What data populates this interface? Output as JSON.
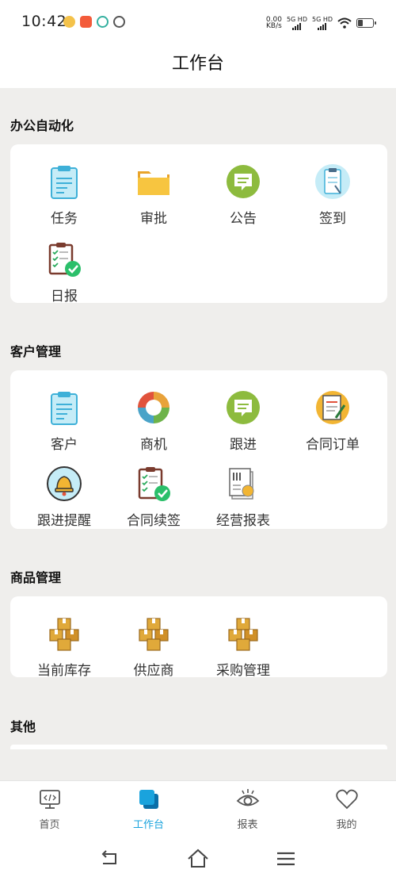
{
  "status_bar": {
    "time": "10:42",
    "net_speed_value": "0.00",
    "net_speed_unit": "KB/s",
    "sim1": "5G HD",
    "sim2": "5G HD"
  },
  "header": {
    "title": "工作台"
  },
  "sections": {
    "office": {
      "title": "办公自动化",
      "items": [
        {
          "label": "任务",
          "icon": "clipboard-icon"
        },
        {
          "label": "审批",
          "icon": "folder-icon"
        },
        {
          "label": "公告",
          "icon": "message-icon"
        },
        {
          "label": "签到",
          "icon": "checkin-icon"
        },
        {
          "label": "日报",
          "icon": "checklist-icon"
        }
      ]
    },
    "customer": {
      "title": "客户管理",
      "items": [
        {
          "label": "客户",
          "icon": "clipboard-icon"
        },
        {
          "label": "商机",
          "icon": "cycle-icon"
        },
        {
          "label": "跟进",
          "icon": "message-icon"
        },
        {
          "label": "合同订单",
          "icon": "contract-icon"
        },
        {
          "label": "跟进提醒",
          "icon": "bell-icon"
        },
        {
          "label": "合同续签",
          "icon": "checklist-icon"
        },
        {
          "label": "经营报表",
          "icon": "report-icon"
        }
      ]
    },
    "goods": {
      "title": "商品管理",
      "items": [
        {
          "label": "当前库存",
          "icon": "boxes-icon"
        },
        {
          "label": "供应商",
          "icon": "boxes-icon"
        },
        {
          "label": "采购管理",
          "icon": "boxes-icon"
        }
      ]
    },
    "other": {
      "title": "其他"
    }
  },
  "bottom_nav": {
    "items": [
      {
        "label": "首页",
        "icon": "monitor-icon"
      },
      {
        "label": "工作台",
        "icon": "workbench-icon"
      },
      {
        "label": "报表",
        "icon": "eye-icon"
      },
      {
        "label": "我的",
        "icon": "heart-icon"
      }
    ]
  },
  "colors": {
    "accent": "#1aa3dd",
    "background": "#efeeec"
  }
}
